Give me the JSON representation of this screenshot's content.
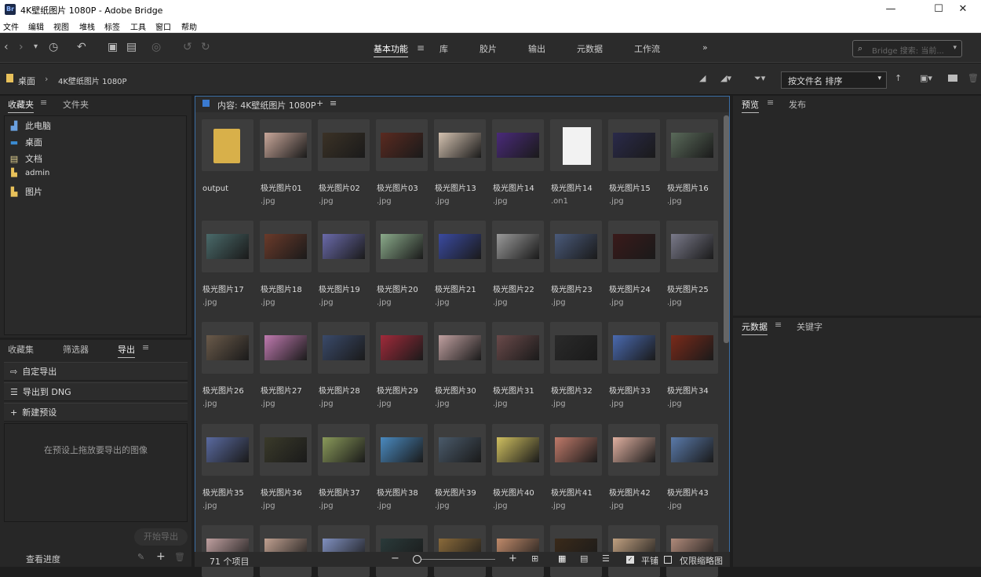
{
  "window": {
    "title": "4K壁纸图片 1080P - Adobe Bridge",
    "app_icon": "Br"
  },
  "menu": [
    "文件",
    "编辑",
    "视图",
    "堆栈",
    "标签",
    "工具",
    "窗口",
    "帮助"
  ],
  "workspaces": [
    "基本功能",
    "库",
    "胶片",
    "输出",
    "元数据",
    "工作流"
  ],
  "workspace_more": "»",
  "search": {
    "placeholder": "Bridge 搜索: 当前..."
  },
  "path": [
    "桌面",
    "4K壁纸图片 1080P"
  ],
  "sort": {
    "label": "按文件名 排序"
  },
  "left_top_tabs": [
    "收藏夹",
    "文件夹"
  ],
  "favorites": [
    {
      "label": "此电脑",
      "icon": "computer-icon"
    },
    {
      "label": "桌面",
      "icon": "desktop-icon"
    },
    {
      "label": "文档",
      "icon": "document-icon"
    },
    {
      "label": "admin",
      "icon": "user-folder-icon"
    },
    {
      "label": "图片",
      "icon": "pictures-icon"
    }
  ],
  "left_bottom_tabs": [
    "收藏集",
    "筛选器",
    "导出"
  ],
  "export_rows": [
    {
      "label": "自定导出",
      "icon": "export-icon"
    },
    {
      "label": "导出到 DNG",
      "icon": "list-icon"
    },
    {
      "label": "新建预设",
      "icon": "plus-icon"
    }
  ],
  "export_hint": "在预设上拖放要导出的图像",
  "start_export": "开始导出",
  "view_progress": "查看进度",
  "content_title": "内容: 4K壁纸图片 1080P",
  "right_top_tabs": [
    "预览",
    "发布"
  ],
  "right_bottom_tabs": [
    "元数据",
    "关键字"
  ],
  "status": {
    "count": "71 个项目",
    "tile": "平铺",
    "thumbs_only": "仅限缩略图"
  },
  "items": [
    {
      "name": "output",
      "ext": "",
      "kind": "folder",
      "color": "#d8b04a"
    },
    {
      "name": "极光图片01",
      "ext": ".jpg",
      "color": "#c9a79a"
    },
    {
      "name": "极光图片02",
      "ext": ".jpg",
      "color": "#3b3226"
    },
    {
      "name": "极光图片03",
      "ext": ".jpg",
      "color": "#5a2a20"
    },
    {
      "name": "极光图片13",
      "ext": ".jpg",
      "color": "#d4c2b0"
    },
    {
      "name": "极光图片14",
      "ext": ".jpg",
      "color": "#4a2a7a"
    },
    {
      "name": "极光图片14",
      "ext": ".on1",
      "kind": "file",
      "color": "#f2f2f2"
    },
    {
      "name": "极光图片15",
      "ext": ".jpg",
      "color": "#2a2a4a"
    },
    {
      "name": "极光图片16",
      "ext": ".jpg",
      "color": "#5a6a5a"
    },
    {
      "name": "极光图片17",
      "ext": ".jpg",
      "color": "#4a6a6a"
    },
    {
      "name": "极光图片18",
      "ext": ".jpg",
      "color": "#6a3a2a"
    },
    {
      "name": "极光图片19",
      "ext": ".jpg",
      "color": "#6a6aaa"
    },
    {
      "name": "极光图片20",
      "ext": ".jpg",
      "color": "#8aaa8a"
    },
    {
      "name": "极光图片21",
      "ext": ".jpg",
      "color": "#3a4aa0"
    },
    {
      "name": "极光图片22",
      "ext": ".jpg",
      "color": "#9a9a9a"
    },
    {
      "name": "极光图片23",
      "ext": ".jpg",
      "color": "#4a5a7a"
    },
    {
      "name": "极光图片24",
      "ext": ".jpg",
      "color": "#3a1a1a"
    },
    {
      "name": "极光图片25",
      "ext": ".jpg",
      "color": "#7a7a8a"
    },
    {
      "name": "极光图片26",
      "ext": ".jpg",
      "color": "#6a5a4a"
    },
    {
      "name": "极光图片27",
      "ext": ".jpg",
      "color": "#c07ab0"
    },
    {
      "name": "极光图片28",
      "ext": ".jpg",
      "color": "#3a4a6a"
    },
    {
      "name": "极光图片29",
      "ext": ".jpg",
      "color": "#a02a3a"
    },
    {
      "name": "极光图片30",
      "ext": ".jpg",
      "color": "#c0a0a0"
    },
    {
      "name": "极光图片31",
      "ext": ".jpg",
      "color": "#6a4a4a"
    },
    {
      "name": "极光图片32",
      "ext": ".jpg",
      "color": "#2a2a2a"
    },
    {
      "name": "极光图片33",
      "ext": ".jpg",
      "color": "#4a6ab0"
    },
    {
      "name": "极光图片34",
      "ext": ".jpg",
      "color": "#7a2a1a"
    },
    {
      "name": "极光图片35",
      "ext": ".jpg",
      "color": "#5a6aa0"
    },
    {
      "name": "极光图片36",
      "ext": ".jpg",
      "color": "#3a3a2a"
    },
    {
      "name": "极光图片37",
      "ext": ".jpg",
      "color": "#8a9a5a"
    },
    {
      "name": "极光图片38",
      "ext": ".jpg",
      "color": "#4a8ac0"
    },
    {
      "name": "极光图片39",
      "ext": ".jpg",
      "color": "#4a5a6a"
    },
    {
      "name": "极光图片40",
      "ext": ".jpg",
      "color": "#d0c060"
    },
    {
      "name": "极光图片41",
      "ext": ".jpg",
      "color": "#c07a6a"
    },
    {
      "name": "极光图片42",
      "ext": ".jpg",
      "color": "#e0b0a0"
    },
    {
      "name": "极光图片43",
      "ext": ".jpg",
      "color": "#5a7aaa"
    },
    {
      "name": "",
      "ext": "",
      "color": "#c0a0a0"
    },
    {
      "name": "",
      "ext": "",
      "color": "#c0a090"
    },
    {
      "name": "",
      "ext": "",
      "color": "#8090c0"
    },
    {
      "name": "",
      "ext": "",
      "color": "#2a3a3a"
    },
    {
      "name": "",
      "ext": "",
      "color": "#8a6a3a"
    },
    {
      "name": "",
      "ext": "",
      "color": "#c08a6a"
    },
    {
      "name": "",
      "ext": "",
      "color": "#3a2a1a"
    },
    {
      "name": "",
      "ext": "",
      "color": "#c0a080"
    },
    {
      "name": "",
      "ext": "",
      "color": "#b08a7a"
    }
  ]
}
